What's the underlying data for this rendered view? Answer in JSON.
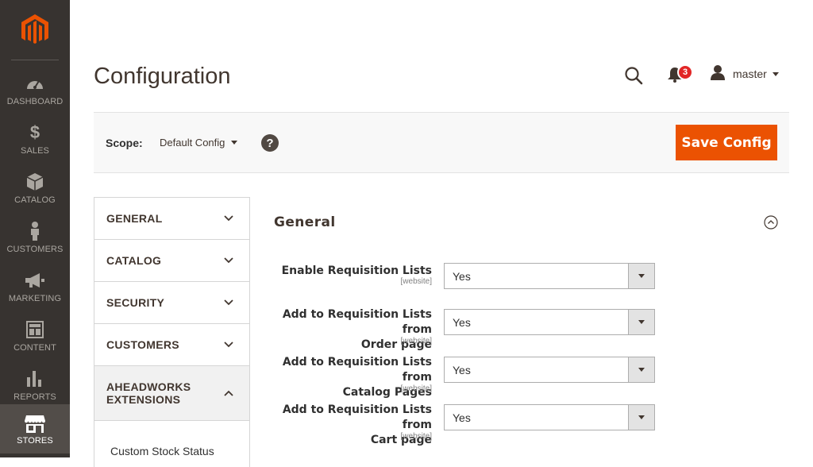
{
  "sidebar": {
    "logo_icon": "magento-logo-icon",
    "items": [
      {
        "label": "DASHBOARD",
        "icon": "dashboard-gauge-icon"
      },
      {
        "label": "SALES",
        "icon": "dollar-icon"
      },
      {
        "label": "CATALOG",
        "icon": "box-icon"
      },
      {
        "label": "CUSTOMERS",
        "icon": "person-icon"
      },
      {
        "label": "MARKETING",
        "icon": "megaphone-icon"
      },
      {
        "label": "CONTENT",
        "icon": "layout-icon"
      },
      {
        "label": "REPORTS",
        "icon": "bar-chart-icon"
      },
      {
        "label": "STORES",
        "icon": "store-icon",
        "active": true
      }
    ]
  },
  "header": {
    "title": "Configuration",
    "notifications_count": "3",
    "user_name": "master"
  },
  "scope": {
    "label": "Scope:",
    "value": "Default Config",
    "help": "?",
    "save_label": "Save Config"
  },
  "tabs": [
    {
      "label": "GENERAL"
    },
    {
      "label": "CATALOG"
    },
    {
      "label": "SECURITY"
    },
    {
      "label": "CUSTOMERS"
    },
    {
      "label_line1": "AHEADWORKS",
      "label_line2": "EXTENSIONS",
      "open": true
    }
  ],
  "tab_subitems": [
    "Custom Stock Status"
  ],
  "section": {
    "title": "General",
    "fields": [
      {
        "label_line1": "Enable Requisition Lists",
        "label_line2": "",
        "scope": "[website]",
        "value": "Yes"
      },
      {
        "label_line1": "Add to Requisition Lists from",
        "label_line2": "Order page",
        "scope": "[website]",
        "value": "Yes"
      },
      {
        "label_line1": "Add to Requisition Lists from",
        "label_line2": "Catalog Pages",
        "scope": "[website]",
        "value": "Yes"
      },
      {
        "label_line1": "Add to Requisition Lists from",
        "label_line2": "Cart page",
        "scope": "[website]",
        "value": "Yes"
      }
    ]
  },
  "colors": {
    "sidebar_bg": "#373330",
    "accent": "#eb5202",
    "badge": "#e22626"
  }
}
